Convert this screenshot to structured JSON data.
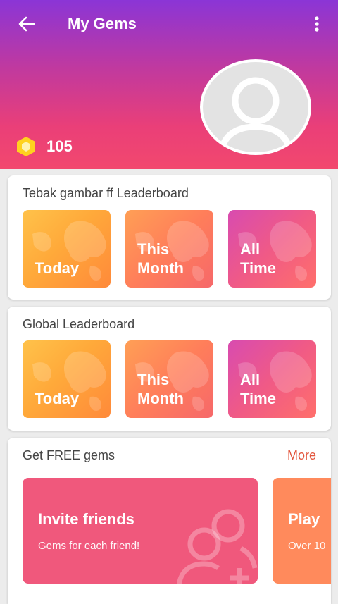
{
  "header": {
    "title": "My Gems",
    "gem_count": "105",
    "icons": [
      "back-arrow-icon",
      "more-vertical-icon",
      "user-avatar-icon",
      "gem-icon"
    ],
    "gradient": [
      "#8b35d6",
      "#f2486e"
    ]
  },
  "leaderboards": [
    {
      "title": "Tebak gambar ff Leaderboard",
      "tiles": [
        {
          "label": "Today"
        },
        {
          "label": "This\nMonth"
        },
        {
          "label": "All\nTime"
        }
      ]
    },
    {
      "title": "Global Leaderboard",
      "tiles": [
        {
          "label": "Today"
        },
        {
          "label": "This\nMonth"
        },
        {
          "label": "All\nTime"
        }
      ]
    }
  ],
  "free_gems": {
    "title": "Get FREE gems",
    "more_label": "More",
    "cards": [
      {
        "title": "Invite friends",
        "subtitle": "Gems for each friend!",
        "color": "#f0587c"
      },
      {
        "title": "Play ",
        "subtitle": "Over 10",
        "color": "#ff8a5c"
      }
    ]
  },
  "colors": {
    "accent": "#e2543b",
    "gem": "#ffd21f"
  }
}
